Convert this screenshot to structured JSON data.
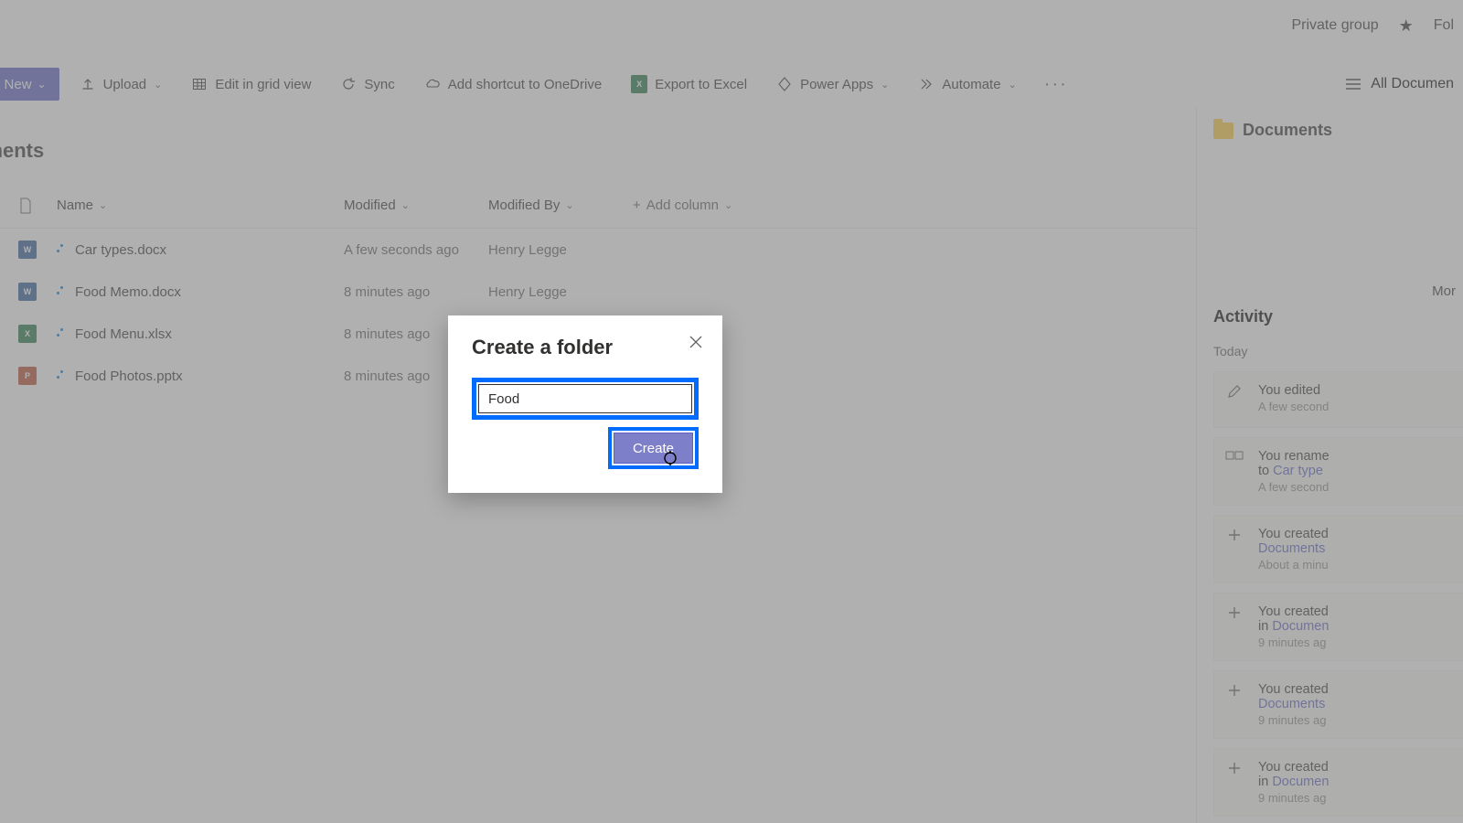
{
  "header": {
    "group_label": "Private group",
    "follow_label": "Fol"
  },
  "toolbar": {
    "new_label": "New",
    "upload_label": "Upload",
    "edit_grid_label": "Edit in grid view",
    "sync_label": "Sync",
    "add_shortcut_label": "Add shortcut to OneDrive",
    "export_excel_label": "Export to Excel",
    "power_apps_label": "Power Apps",
    "automate_label": "Automate",
    "all_documents_label": "All Documen"
  },
  "page": {
    "title": "uments"
  },
  "columns": {
    "name": "Name",
    "modified": "Modified",
    "modified_by": "Modified By",
    "add_column": "Add column"
  },
  "rows": [
    {
      "icon": "w",
      "badge": "W",
      "name": "Car types.docx",
      "modified": "A few seconds ago",
      "by": "Henry Legge"
    },
    {
      "icon": "w",
      "badge": "W",
      "name": "Food Memo.docx",
      "modified": "8 minutes ago",
      "by": "Henry Legge"
    },
    {
      "icon": "x",
      "badge": "X",
      "name": "Food Menu.xlsx",
      "modified": "8 minutes ago",
      "by": ""
    },
    {
      "icon": "p",
      "badge": "P",
      "name": "Food Photos.pptx",
      "modified": "8 minutes ago",
      "by": ""
    }
  ],
  "side": {
    "title": "Documents",
    "more": "Mor",
    "activity": "Activity",
    "today": "Today",
    "items": [
      {
        "icon": "pencil",
        "line": "You edited",
        "link": "",
        "ts": "A few second"
      },
      {
        "icon": "rename",
        "line": "You rename",
        "prefix": "to ",
        "link": "Car type",
        "ts": "A few second"
      },
      {
        "icon": "plus",
        "line": "You created",
        "link": "Documents",
        "ts": "About a minu"
      },
      {
        "icon": "plus",
        "line": "You created",
        "prefix": "in ",
        "link": "Documen",
        "ts": "9 minutes ag"
      },
      {
        "icon": "plus",
        "line": "You created",
        "link": "Documents",
        "ts": "9 minutes ag"
      },
      {
        "icon": "plus",
        "line": "You created",
        "prefix": "in ",
        "link": "Documen",
        "ts": "9 minutes ag"
      }
    ]
  },
  "modal": {
    "title": "Create a folder",
    "input_value": "Food",
    "create_label": "Create"
  }
}
